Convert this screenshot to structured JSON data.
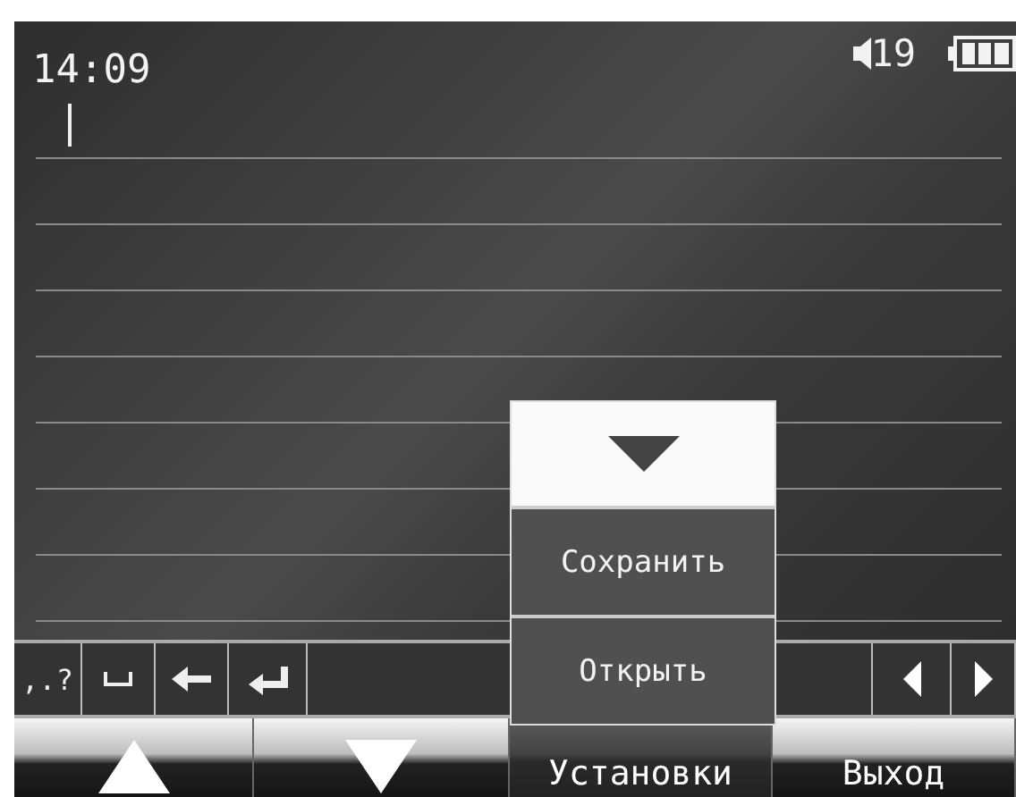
{
  "status_bar": {
    "time": "14:09",
    "volume": "19"
  },
  "toolbar": {
    "left_keys": [
      {
        "kind": "text",
        "label": ",.?"
      },
      {
        "kind": "space"
      },
      {
        "kind": "backspace"
      },
      {
        "kind": "enter"
      }
    ],
    "right_keys": [
      {
        "kind": "left"
      },
      {
        "kind": "right"
      }
    ]
  },
  "menu": {
    "items": [
      "Сохранить",
      "Открыть"
    ]
  },
  "softkeys": [
    {
      "kind": "up",
      "selected": false
    },
    {
      "kind": "down",
      "selected": false
    },
    {
      "kind": "text",
      "label": "Установки",
      "selected": true
    },
    {
      "kind": "text",
      "label": "Выход",
      "selected": false
    }
  ]
}
